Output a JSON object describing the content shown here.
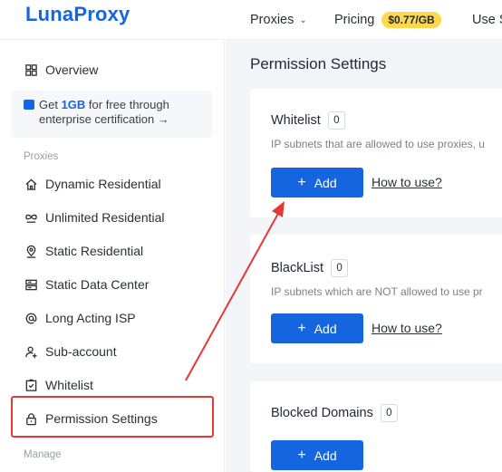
{
  "header": {
    "logo": "LunaProxy",
    "nav": {
      "proxies": "Proxies",
      "pricing": "Pricing",
      "price_badge": "$0.77/GB",
      "use": "Use S"
    }
  },
  "sidebar": {
    "overview": "Overview",
    "promo": {
      "prefix": "Get ",
      "highlight": "1GB",
      "suffix": " for free through",
      "line2": "enterprise certification →"
    },
    "section_proxies": "Proxies",
    "items": [
      {
        "label": "Dynamic Residential",
        "icon": "home-icon"
      },
      {
        "label": "Unlimited Residential",
        "icon": "infinity-icon"
      },
      {
        "label": "Static Residential",
        "icon": "location-pin-icon"
      },
      {
        "label": "Static Data Center",
        "icon": "server-icon"
      },
      {
        "label": "Long Acting ISP",
        "icon": "at-sign-icon"
      },
      {
        "label": "Sub-account",
        "icon": "user-add-icon"
      },
      {
        "label": "Whitelist",
        "icon": "clipboard-check-icon"
      },
      {
        "label": "Permission Settings",
        "icon": "lock-icon"
      }
    ],
    "section_manage": "Manage"
  },
  "main": {
    "title": "Permission Settings",
    "cards": [
      {
        "title": "Whitelist",
        "count": "0",
        "description": "IP subnets that are allowed to use proxies, u",
        "add_label": "Add",
        "howto_label": "How to use?"
      },
      {
        "title": "BlackList",
        "count": "0",
        "description": "IP subnets which are NOT allowed to use pr",
        "add_label": "Add",
        "howto_label": "How to use?"
      },
      {
        "title": "Blocked Domains",
        "count": "0",
        "add_label": "Add"
      }
    ]
  },
  "colors": {
    "brand": "#1565e0",
    "badge": "#ffd84d",
    "annotation": "#e53935"
  }
}
